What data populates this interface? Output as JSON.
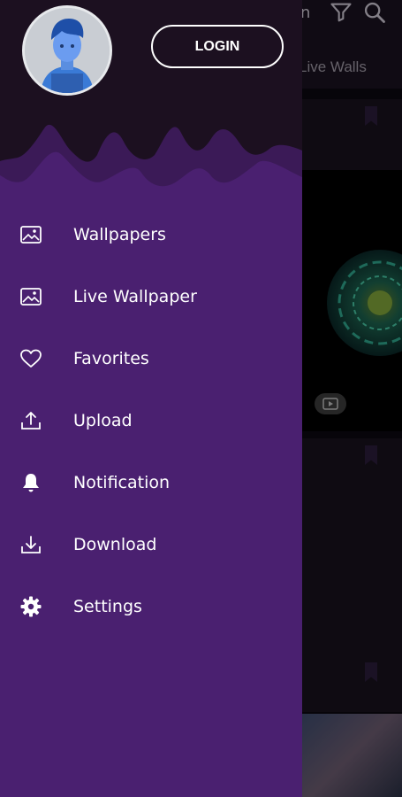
{
  "background_app": {
    "header_partial_text": "n",
    "tab_partial_label": "Live Walls",
    "icons": [
      "filter-icon",
      "search-icon",
      "play-icon",
      "bookmark-icon"
    ]
  },
  "drawer": {
    "login_label": "LOGIN",
    "avatar_icon": "avatar-icon",
    "items": [
      {
        "label": "Wallpapers",
        "icon": "image-icon"
      },
      {
        "label": "Live Wallpaper",
        "icon": "image-icon"
      },
      {
        "label": "Favorites",
        "icon": "heart-icon"
      },
      {
        "label": "Upload",
        "icon": "upload-icon"
      },
      {
        "label": "Notification",
        "icon": "bell-icon"
      },
      {
        "label": "Download",
        "icon": "download-icon"
      },
      {
        "label": "Settings",
        "icon": "gear-icon"
      }
    ]
  },
  "colors": {
    "drawer_purple": "#4a2070",
    "header_dark": "#1c1020",
    "wave_mid": "#3b1a57",
    "text": "#ffffff"
  }
}
